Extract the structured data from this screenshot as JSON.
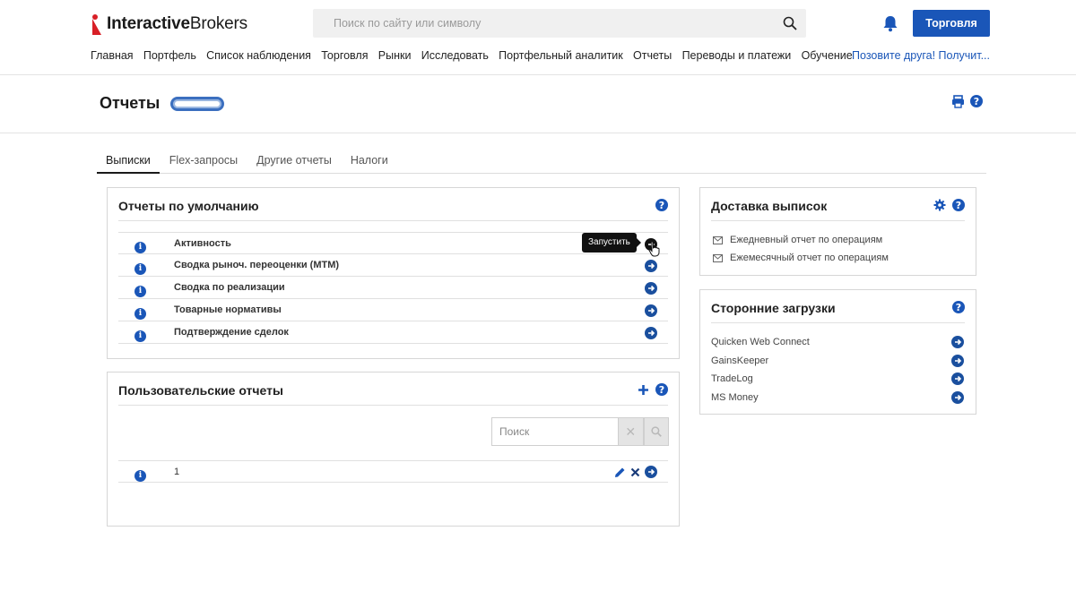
{
  "brand": {
    "part1": "Interactive",
    "part2": "Brokers"
  },
  "search": {
    "placeholder": "Поиск по сайту или символу"
  },
  "trade_button": "Торговля",
  "nav": [
    "Главная",
    "Портфель",
    "Список наблюдения",
    "Торговля",
    "Рынки",
    "Исследовать",
    "Портфельный аналитик",
    "Отчеты",
    "Переводы и платежи",
    "Обучение"
  ],
  "refer_link": "Позовите друга! Получит...",
  "page": {
    "title": "Отчеты"
  },
  "tabs": [
    {
      "label": "Выписки",
      "active": true
    },
    {
      "label": "Flex-запросы",
      "active": false
    },
    {
      "label": "Другие отчеты",
      "active": false
    },
    {
      "label": "Налоги",
      "active": false
    }
  ],
  "default_reports": {
    "title": "Отчеты по умолчанию",
    "items": [
      "Активность",
      "Сводка рыноч. переоценки (MTM)",
      "Сводка по реализации",
      "Товарные нормативы",
      "Подтверждение сделок"
    ],
    "tooltip": "Запустить"
  },
  "custom_reports": {
    "title": "Пользовательские отчеты",
    "search_placeholder": "Поиск",
    "items": [
      "1"
    ]
  },
  "delivery": {
    "title": "Доставка выписок",
    "items": [
      "Ежедневный отчет по операциям",
      "Ежемесячный отчет по операциям"
    ]
  },
  "third_party": {
    "title": "Сторонние загрузки",
    "items": [
      "Quicken Web Connect",
      "GainsKeeper",
      "TradeLog",
      "MS Money"
    ]
  },
  "colors": {
    "accent": "#1a56b8",
    "brand_red": "#d81f26"
  },
  "icons": [
    "search-icon",
    "bell-icon",
    "print-icon",
    "help-icon",
    "info-icon",
    "arrow-right-circle-icon",
    "plus-icon",
    "gear-icon",
    "envelope-icon",
    "pencil-icon",
    "close-icon"
  ]
}
